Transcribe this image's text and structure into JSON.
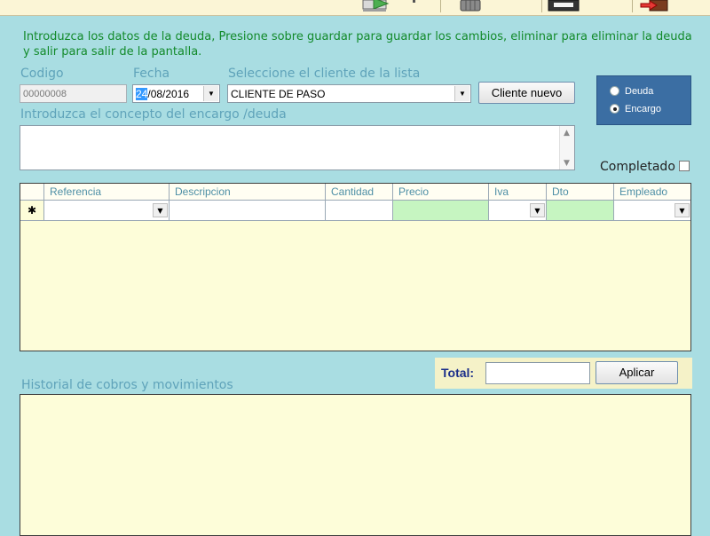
{
  "instructions": "Introduzca los datos de la deuda, Presione sobre guardar para guardar los cambios, eliminar para eliminar la deuda y salir para salir de la pantalla.",
  "form": {
    "codigo_label": "Codigo",
    "codigo_value": "00000008",
    "fecha_label": "Fecha",
    "fecha_day": "24",
    "fecha_rest": "/08/2016",
    "cliente_label": "Seleccione el cliente de la lista",
    "cliente_value": "CLIENTE DE PASO",
    "cliente_nuevo_button": "Cliente nuevo",
    "concepto_label": "Introduzca el concepto del encargo /deuda",
    "concepto_value": "",
    "completado_label": "Completado"
  },
  "type_options": [
    {
      "label": "Deuda",
      "selected": false
    },
    {
      "label": "Encargo",
      "selected": true
    }
  ],
  "grid": {
    "new_row_marker": "✱",
    "columns": [
      "Referencia",
      "Descripcion",
      "Cantidad",
      "Precio",
      "Iva",
      "Dto",
      "Empleado"
    ]
  },
  "footer": {
    "total_label": "Total:",
    "total_value": "",
    "aplicar_button": "Aplicar",
    "historial_label": "Historial de cobros y movimientos"
  },
  "colors": {
    "background": "#a9dde2",
    "instructions_text": "#128a2a",
    "label_text": "#5fa3ba",
    "radio_panel": "#3b6ea3",
    "grid_bg": "#fdfdd9",
    "editable_price_cell": "#c6f5c1"
  },
  "toolbar_icons": [
    "save-icon",
    "delete-trash-icon",
    "floppy-disk-icon",
    "exit-icon"
  ]
}
